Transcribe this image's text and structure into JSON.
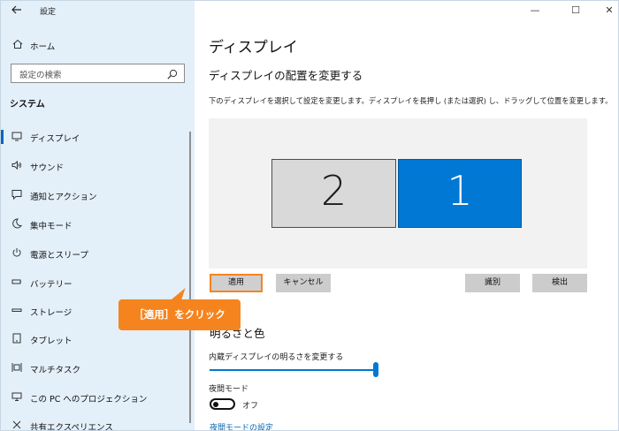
{
  "window": {
    "app_title": "設定",
    "back_icon": "back-arrow-icon",
    "caption": {
      "minimize": "—",
      "maximize": "☐",
      "close": "✕"
    }
  },
  "sidebar": {
    "home_label": "ホーム",
    "search_placeholder": "設定の検索",
    "section_title": "システム",
    "items": [
      {
        "label": "ディスプレイ",
        "icon": "monitor-icon",
        "active": true
      },
      {
        "label": "サウンド",
        "icon": "speaker-icon"
      },
      {
        "label": "通知とアクション",
        "icon": "notification-icon"
      },
      {
        "label": "集中モード",
        "icon": "moon-icon"
      },
      {
        "label": "電源とスリープ",
        "icon": "power-icon"
      },
      {
        "label": "バッテリー",
        "icon": "battery-icon"
      },
      {
        "label": "ストレージ",
        "icon": "storage-icon"
      },
      {
        "label": "タブレット",
        "icon": "tablet-icon"
      },
      {
        "label": "マルチタスク",
        "icon": "multitask-icon"
      },
      {
        "label": "この PC へのプロジェクション",
        "icon": "projection-icon"
      },
      {
        "label": "共有エクスペリエンス",
        "icon": "shared-experience-icon"
      }
    ]
  },
  "main": {
    "page_title": "ディスプレイ",
    "arrange_title": "ディスプレイの配置を変更する",
    "arrange_desc": "下のディスプレイを選択して設定を変更します。ディスプレイを長押し (または選択) し、ドラッグして位置を変更します。",
    "monitors": [
      {
        "number": "2",
        "selected": false
      },
      {
        "number": "1",
        "selected": true
      }
    ],
    "buttons": {
      "apply": "適用",
      "cancel": "キャンセル",
      "identify": "識別",
      "detect": "検出"
    },
    "brightness_title": "明るさと色",
    "brightness_label": "内蔵ディスプレイの明るさを変更する",
    "brightness_value": 1.0,
    "night_mode_label": "夜間モード",
    "night_mode_state": "オフ",
    "night_mode_link": "夜間モードの設定"
  },
  "callout": {
    "text": "［適用］をクリック"
  },
  "colors": {
    "sidebar_bg": "#e3eff9",
    "accent": "#0078d4",
    "callout": "#f5841f"
  }
}
